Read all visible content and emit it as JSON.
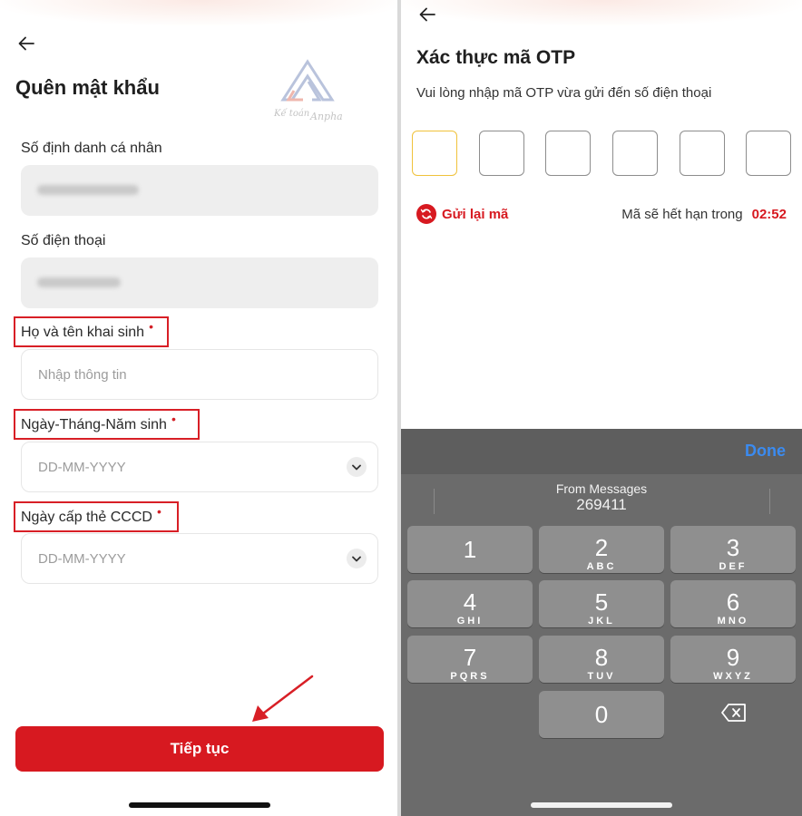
{
  "left": {
    "title": "Quên mật khẩu",
    "logo_text": "Kế toán Anpha",
    "fields": [
      {
        "label": "Số định danh cá nhân",
        "value": "",
        "required": false
      },
      {
        "label": "Số điện thoại",
        "value": "",
        "required": false
      },
      {
        "label": "Họ và tên khai sinh",
        "placeholder": "Nhập thông tin",
        "required": true
      },
      {
        "label": "Ngày-Tháng-Năm sinh",
        "placeholder": "DD-MM-YYYY",
        "required": true
      },
      {
        "label": "Ngày cấp thẻ CCCD",
        "placeholder": "DD-MM-YYYY",
        "required": true
      }
    ],
    "required_mark": "•",
    "cta_label": "Tiếp tục"
  },
  "right": {
    "title": "Xác thực mã OTP",
    "subtitle": "Vui lòng nhập mã OTP vừa gửi đến số điện thoại",
    "resend_label": "Gửi lại mã",
    "expire_label": "Mã sẽ hết hạn trong",
    "countdown": "02:52",
    "keyboard": {
      "done_label": "Done",
      "suggestion_source": "From Messages",
      "suggestion_code": "269411",
      "keys": [
        {
          "digit": "1",
          "letters": ""
        },
        {
          "digit": "2",
          "letters": "ABC"
        },
        {
          "digit": "3",
          "letters": "DEF"
        },
        {
          "digit": "4",
          "letters": "GHI"
        },
        {
          "digit": "5",
          "letters": "JKL"
        },
        {
          "digit": "6",
          "letters": "MNO"
        },
        {
          "digit": "7",
          "letters": "PQRS"
        },
        {
          "digit": "8",
          "letters": "TUV"
        },
        {
          "digit": "9",
          "letters": "WXYZ"
        },
        {
          "digit": "0",
          "letters": ""
        }
      ]
    }
  },
  "colors": {
    "brand_red": "#d71920",
    "highlight_red": "#d81f26",
    "done_blue": "#3b8bf0",
    "active_otp": "#f0c23b"
  }
}
